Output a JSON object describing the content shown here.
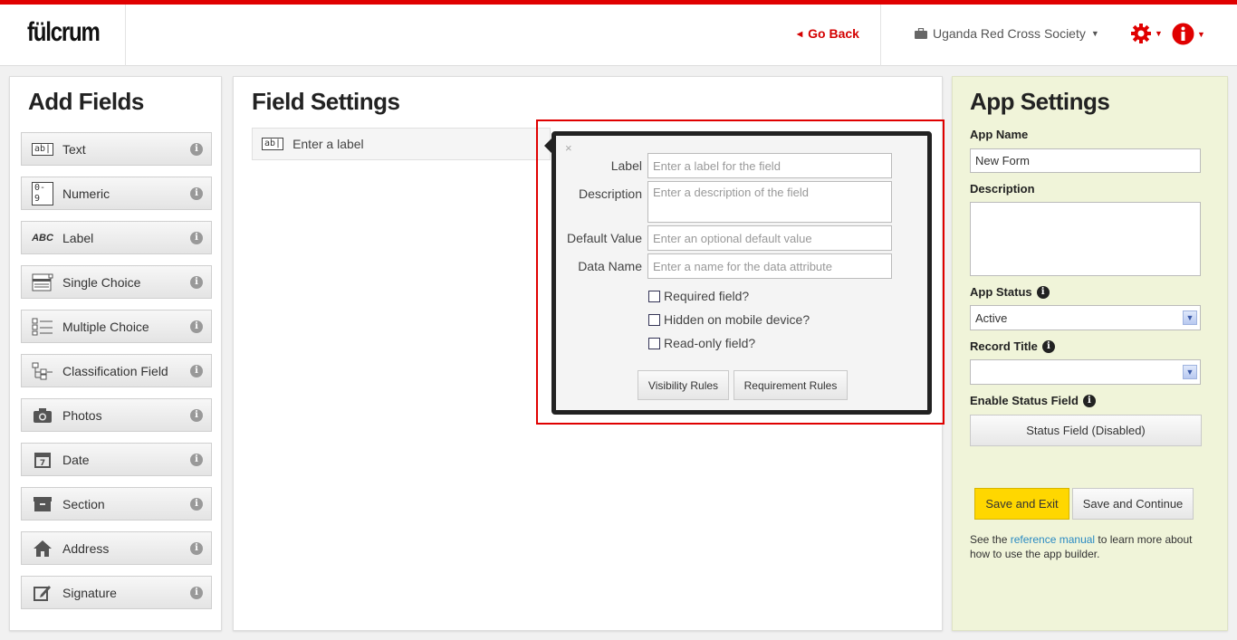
{
  "header": {
    "logo": "fülcrum",
    "go_back": "Go Back",
    "organization": "Uganda Red Cross Society",
    "settings_icon": "gear-icon",
    "info_icon": "info-icon",
    "accent_color": "#e00000"
  },
  "add_fields": {
    "title": "Add Fields",
    "items": [
      {
        "label": "Text",
        "icon": "text-field-icon"
      },
      {
        "label": "Numeric",
        "icon": "numeric-icon"
      },
      {
        "label": "Label",
        "icon": "label-abc-icon"
      },
      {
        "label": "Single Choice",
        "icon": "single-choice-icon"
      },
      {
        "label": "Multiple Choice",
        "icon": "multiple-choice-icon"
      },
      {
        "label": "Classification Field",
        "icon": "classification-icon"
      },
      {
        "label": "Photos",
        "icon": "camera-icon"
      },
      {
        "label": "Date",
        "icon": "calendar-icon"
      },
      {
        "label": "Section",
        "icon": "section-box-icon"
      },
      {
        "label": "Address",
        "icon": "home-icon"
      },
      {
        "label": "Signature",
        "icon": "signature-pen-icon"
      }
    ]
  },
  "field_settings": {
    "title": "Field Settings",
    "row_label": "Enter a label",
    "popover": {
      "close": "×",
      "label_caption": "Label",
      "label_placeholder": "Enter a label for the field",
      "description_caption": "Description",
      "description_placeholder": "Enter a description of the field",
      "default_caption": "Default Value",
      "default_placeholder": "Enter an optional default value",
      "data_name_caption": "Data Name",
      "data_name_placeholder": "Enter a name for the data attribute",
      "required": "Required field?",
      "hidden": "Hidden on mobile device?",
      "readonly": "Read-only field?",
      "visibility_rules": "Visibility Rules",
      "requirement_rules": "Requirement Rules"
    }
  },
  "app_settings": {
    "title": "App Settings",
    "app_name_label": "App Name",
    "app_name_value": "New Form",
    "description_label": "Description",
    "description_value": "",
    "app_status_label": "App Status",
    "app_status_value": "Active",
    "record_title_label": "Record Title",
    "record_title_value": "",
    "enable_status_label": "Enable Status Field",
    "status_button": "Status Field (Disabled)",
    "save_exit": "Save and Exit",
    "save_continue": "Save and Continue",
    "help_prefix": "See the ",
    "help_link": "reference manual",
    "help_suffix": " to learn more about how to use the app builder."
  }
}
